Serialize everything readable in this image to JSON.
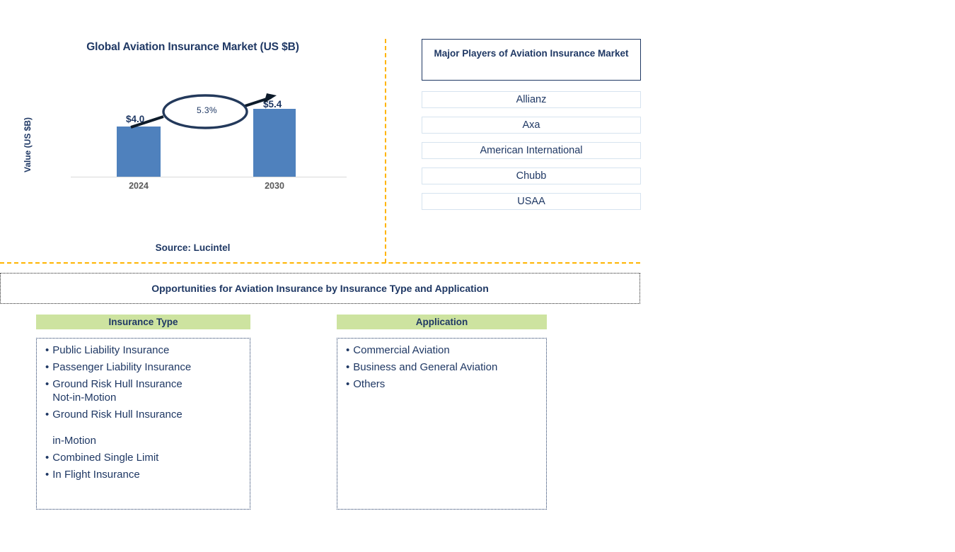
{
  "chart_data": {
    "type": "bar",
    "title": "Global Aviation Insurance Market (US $B)",
    "xlabel": "",
    "ylabel": "Value (US $B)",
    "categories": [
      "2024",
      "2030"
    ],
    "values": [
      4.0,
      5.4
    ],
    "value_labels": [
      "$4.0",
      "$5.4"
    ],
    "ylim": [
      0,
      6.0
    ],
    "grid": false,
    "legend": "none",
    "bar_color": "#4F81BD",
    "annotation": {
      "label": "5.3%",
      "shape": "ellipse",
      "meaning": "CAGR from 2024 to 2030",
      "stroke_color": "#1F3864"
    },
    "source": "Source: Lucintel"
  },
  "chart_panel": {
    "title": "Global Aviation Insurance Market (US $B)",
    "y_axis_label": "Value (US $B)",
    "bars": [
      {
        "tick": "2024",
        "value_label": "$4.0"
      },
      {
        "tick": "2030",
        "value_label": "$5.4"
      }
    ],
    "cagr_label": "5.3%",
    "source": "Source: Lucintel"
  },
  "players_panel": {
    "header": "Major Players of Aviation Insurance Market",
    "items": [
      {
        "label": "Allianz"
      },
      {
        "label": "Axa"
      },
      {
        "label": "American International"
      },
      {
        "label": "Chubb"
      },
      {
        "label": "USAA"
      }
    ]
  },
  "opportunities": {
    "banner": "Opportunities for Aviation Insurance by Insurance Type and Application",
    "columns": [
      {
        "header": "Insurance Type",
        "bullet": "•",
        "items": [
          "Public Liability Insurance",
          "Passenger Liability Insurance",
          "Ground Risk Hull Insurance\n Not-in-Motion",
          "Ground Risk Hull Insurance\n\n in-Motion",
          "Combined Single Limit",
          "In Flight Insurance"
        ]
      },
      {
        "header": "Application",
        "bullet": "•",
        "items": [
          "Commercial Aviation",
          "Business and General Aviation",
          "Others"
        ]
      }
    ]
  },
  "colors": {
    "navy": "#1F3864",
    "bar_blue": "#4F81BD",
    "divider_orange": "#FFB400",
    "header_green": "#CDE3A0"
  }
}
